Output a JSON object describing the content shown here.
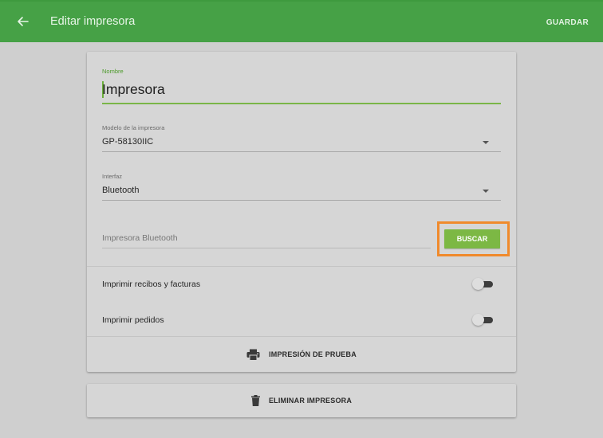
{
  "appbar": {
    "title": "Editar impresora",
    "save_label": "GUARDAR",
    "back_icon": "arrow-left-icon",
    "color": "#46a146"
  },
  "form": {
    "name": {
      "label": "Nombre",
      "value": "Impresora"
    },
    "model": {
      "label": "Modelo de la impresora",
      "value": "GP-58130IIC"
    },
    "interface": {
      "label": "Interfaz",
      "value": "Bluetooth"
    },
    "bluetooth": {
      "placeholder": "Impresora Bluetooth",
      "search_label": "BUSCAR",
      "search_color": "#7cb844",
      "highlight_color": "#f08a2c"
    }
  },
  "toggles": {
    "receipts": {
      "label": "Imprimir recibos y facturas",
      "on": false
    },
    "orders": {
      "label": "Imprimir pedidos",
      "on": false
    }
  },
  "actions": {
    "test_print": {
      "label": "IMPRESIÓN DE PRUEBA",
      "icon": "printer-icon"
    },
    "delete": {
      "label": "ELIMINAR IMPRESORA",
      "icon": "trash-icon"
    }
  }
}
